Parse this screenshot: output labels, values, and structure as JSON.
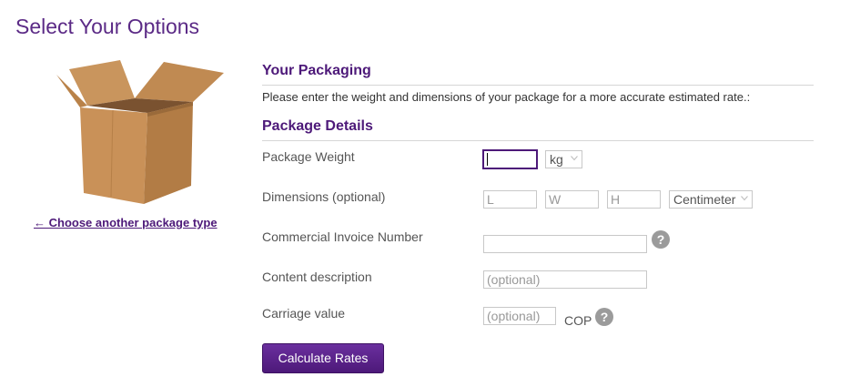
{
  "page": {
    "title": "Select Your Options"
  },
  "left": {
    "choose_link": "← Choose another package type"
  },
  "packaging": {
    "heading": "Your Packaging",
    "intro": "Please enter the weight and dimensions of your package for a more accurate estimated rate.:"
  },
  "details": {
    "heading": "Package Details",
    "weight": {
      "label": "Package Weight",
      "value": "",
      "unit": "kg"
    },
    "dimensions": {
      "label": "Dimensions (optional)",
      "length_placeholder": "L",
      "width_placeholder": "W",
      "height_placeholder": "H",
      "unit": "Centimeter"
    },
    "invoice": {
      "label": "Commercial Invoice Number",
      "value": ""
    },
    "content": {
      "label": "Content description",
      "placeholder": "(optional)"
    },
    "carriage": {
      "label": "Carriage value",
      "placeholder": "(optional)",
      "currency": "COP"
    },
    "help_glyph": "?"
  },
  "actions": {
    "calculate_label": "Calculate Rates"
  },
  "colors": {
    "brand_purple": "#4d1979",
    "title_purple": "#5b2a86"
  },
  "icons": [
    "box-illustration",
    "help-icon",
    "chevron-down-icon"
  ]
}
